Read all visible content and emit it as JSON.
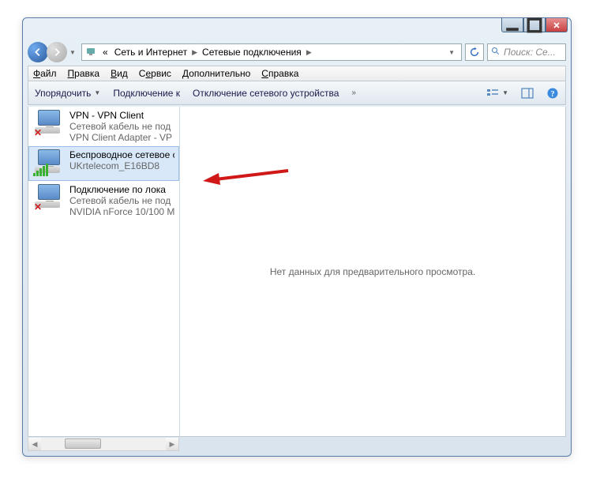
{
  "breadcrumbs": {
    "prefix": "«",
    "item1": "Сеть и Интернет",
    "item2": "Сетевые подключения"
  },
  "search": {
    "placeholder": "Поиск: Се..."
  },
  "menu": {
    "file": "Файл",
    "edit": "Правка",
    "view": "Вид",
    "tools": "Сервис",
    "advanced": "Дополнительно",
    "help": "Справка"
  },
  "toolbar": {
    "organize": "Упорядочить",
    "connect_to": "Подключение к",
    "disable_device": "Отключение сетевого устройства"
  },
  "preview_empty": "Нет данных для предварительного просмотра.",
  "connections": [
    {
      "name": "VPN - VPN Client",
      "status": "Сетевой кабель не под",
      "device": "VPN Client Adapter - VP",
      "selected": false,
      "badge": "x"
    },
    {
      "name": "Беспроводное сетевое соединение",
      "status": "",
      "device": "UKrtelecom_E16BD8",
      "selected": true,
      "badge": "bars"
    },
    {
      "name": "Подключение по лока",
      "status": "Сетевой кабель не под",
      "device": "NVIDIA nForce 10/100 M",
      "selected": false,
      "badge": "x"
    }
  ]
}
